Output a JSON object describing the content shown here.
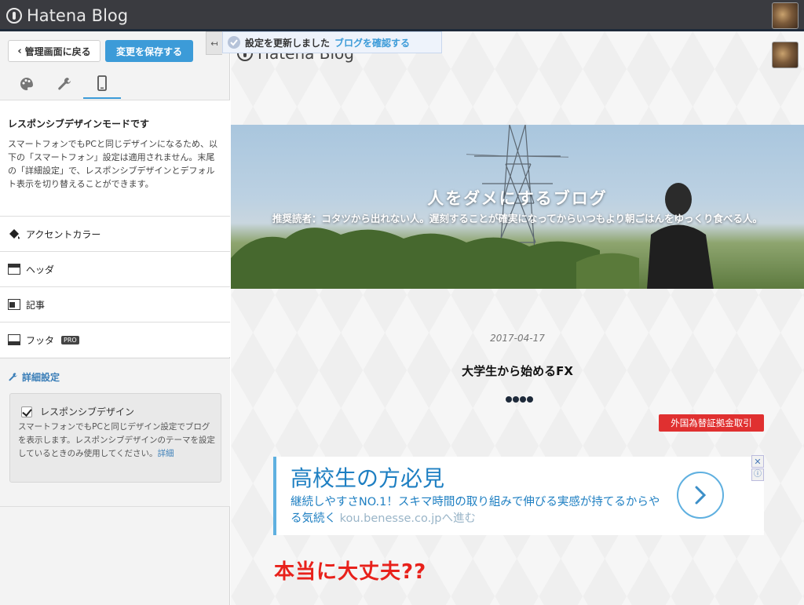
{
  "app": {
    "name": "Hatena Blog"
  },
  "sidebar": {
    "back_label": "管理画面に戻る",
    "save_label": "変更を保存する",
    "tabs": [
      {
        "name": "design",
        "icon": "palette-icon"
      },
      {
        "name": "customize",
        "icon": "wrench-icon"
      },
      {
        "name": "smartphone",
        "icon": "smartphone-icon",
        "active": true
      }
    ],
    "mode_title": "レスポンシブデザインモードです",
    "mode_desc": "スマートフォンでもPCと同じデザインになるため、以下の「スマートフォン」設定は適用されません。末尾の「詳細設定」で、レスポンシブデザインとデフォルト表示を切り替えることができます。",
    "menu": [
      {
        "label": "アクセントカラー",
        "icon": "paint-bucket-icon"
      },
      {
        "label": "ヘッダ",
        "icon": "header-layout-icon"
      },
      {
        "label": "記事",
        "icon": "article-layout-icon"
      },
      {
        "label": "フッタ",
        "icon": "footer-layout-icon",
        "badge": "PRO"
      }
    ],
    "advanced": {
      "title": "詳細設定",
      "checkbox_label": "レスポンシブデザイン",
      "checked": true,
      "desc": "スマートフォンでもPCと同じデザイン設定でブログを表示します。レスポンシブデザインのテーマを設定しているときのみ使用してください。",
      "link": "詳細"
    }
  },
  "toast": {
    "message": "設定を更新しました",
    "link": "ブログを確認する"
  },
  "preview": {
    "logo": "Hatena Blog",
    "blog_title": "人をダメにするブログ",
    "blog_desc": "推奨読者：コタツから出れない人。遅刻することが確実になってからいつもより朝ごはんをゆっくり食べる人。",
    "date": "2017-04-17",
    "article_title": "大学生から始めるFX",
    "ad_label": "外国為替証拠金取引",
    "ad": {
      "headline": "高校生の方必見",
      "body": "継続しやすさNO.1！スキマ時間の取り組みで伸びる実感が持てるからやる気続く",
      "url": "kou.benesse.co.jpへ進む",
      "close": "✕",
      "info": "ⓘ"
    },
    "annotation": "本当に大丈夫??"
  },
  "colors": {
    "accent": "#3c9bd8",
    "topbar": "#3a3b40",
    "annotation": "#e8211b",
    "ad_label": "#e03030"
  }
}
